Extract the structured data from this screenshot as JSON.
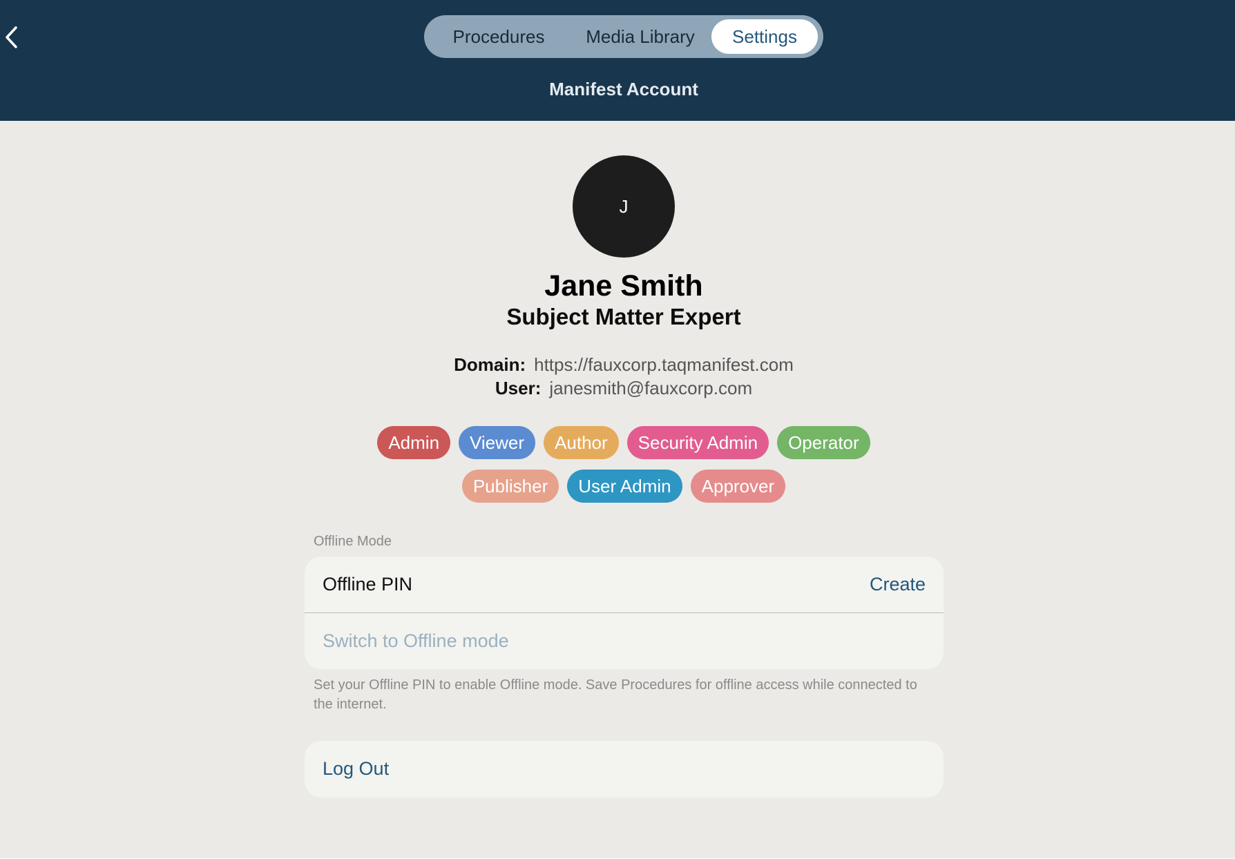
{
  "header": {
    "tabs": [
      {
        "label": "Procedures",
        "selected": false
      },
      {
        "label": "Media Library",
        "selected": false
      },
      {
        "label": "Settings",
        "selected": true
      }
    ],
    "title": "Manifest Account",
    "back_icon": "chevron-left-icon"
  },
  "profile": {
    "avatar_initial": "J",
    "name": "Jane Smith",
    "role": "Subject Matter Expert",
    "domain_label": "Domain:",
    "domain_value": "https://fauxcorp.taqmanifest.com",
    "user_label": "User:",
    "user_value": "janesmith@fauxcorp.com"
  },
  "roles": [
    {
      "label": "Admin",
      "color": "#cc5757"
    },
    {
      "label": "Viewer",
      "color": "#5b8bd1"
    },
    {
      "label": "Author",
      "color": "#e5ab5c"
    },
    {
      "label": "Security Admin",
      "color": "#e25c90"
    },
    {
      "label": "Operator",
      "color": "#74b566"
    },
    {
      "label": "Publisher",
      "color": "#e7a28c"
    },
    {
      "label": "User Admin",
      "color": "#2d96c3"
    },
    {
      "label": "Approver",
      "color": "#e58b8b"
    }
  ],
  "offline": {
    "section_label": "Offline Mode",
    "pin_label": "Offline PIN",
    "pin_action": "Create",
    "switch_label": "Switch to Offline mode",
    "footnote": "Set your Offline PIN to enable Offline mode. Save Procedures for offline access while connected to the internet."
  },
  "account": {
    "logout_label": "Log Out"
  },
  "colors": {
    "header_bg": "#18364e",
    "accent": "#23587a",
    "page_bg": "#ebeae7"
  }
}
